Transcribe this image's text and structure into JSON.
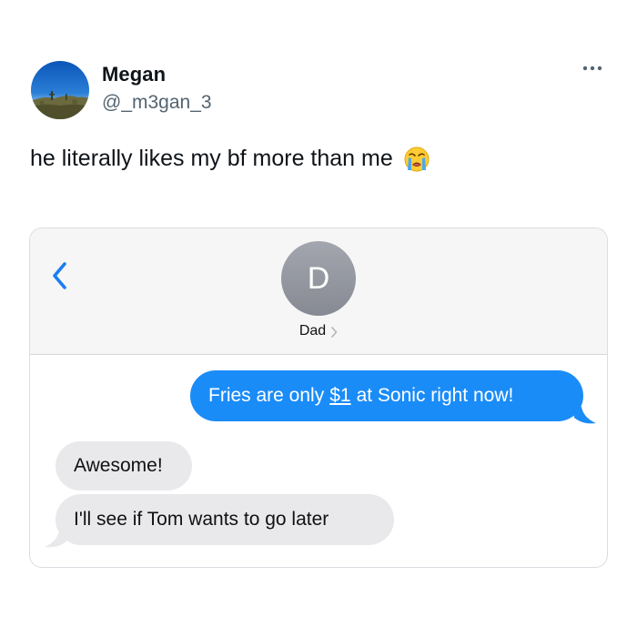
{
  "tweet": {
    "display_name": "Megan",
    "handle": "@_m3gan_3",
    "text": "he literally likes my bf more than me",
    "emoji": "loudly-crying-face-emoji",
    "more_icon": "more-horizontal-icon"
  },
  "imessage": {
    "back_icon": "chevron-left-icon",
    "contact_initial": "D",
    "contact_name": "Dad",
    "messages": [
      {
        "direction": "sent",
        "prefix": "Fries are only",
        "link_text": "$1",
        "suffix": "at Sonic right now!"
      },
      {
        "direction": "received",
        "text": "Awesome!"
      },
      {
        "direction": "received",
        "text": "I'll see if Tom wants to go later"
      }
    ]
  },
  "colors": {
    "sent_bubble": "#1a8cf8",
    "received_bubble": "#e9e9eb",
    "ios_blue": "#1a7ef2",
    "handle_gray": "#536471"
  }
}
